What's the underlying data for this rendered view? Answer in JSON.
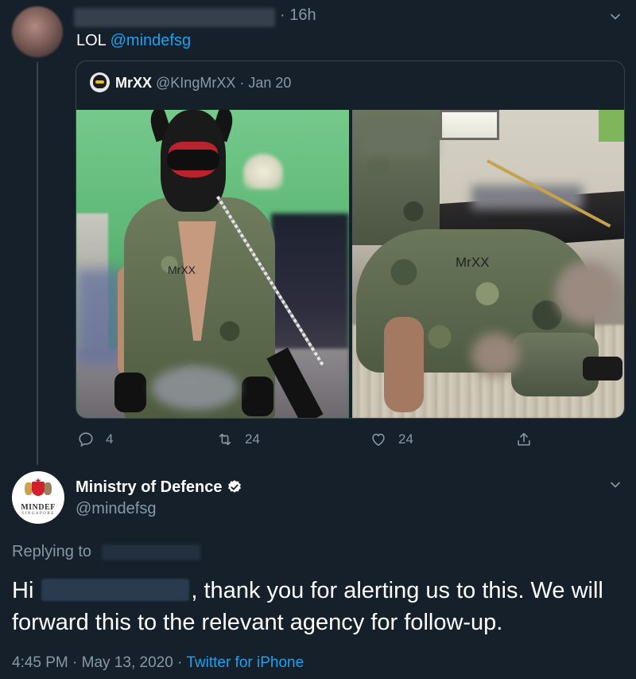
{
  "tweet1": {
    "time": "· 16h",
    "text_prefix": "LOL ",
    "mention": "@mindefsg",
    "quoted": {
      "name": "MrXX",
      "meta": "@KIngMrXX · Jan 20",
      "watermark_left_1": "MrXX",
      "watermark_right_1": "MrXX"
    },
    "actions": {
      "reply_count": "4",
      "retweet_count": "24",
      "like_count": "24"
    }
  },
  "tweet2": {
    "name": "Ministry of Defence",
    "handle": "@mindefsg",
    "avatar_text": "MINDEF",
    "avatar_subtext": "SINGAPORE",
    "replying_label": "Replying to",
    "body_hi": "Hi",
    "body_rest": ", thank you for alerting us to this. We will forward this to the relevant agency for follow-up.",
    "timestamp": "4:45 PM · May 13, 2020 · ",
    "source": "Twitter for iPhone"
  },
  "colors": {
    "background": "#15202b",
    "accent": "#1da1f2",
    "muted": "#8899a6",
    "border": "#38444d"
  },
  "icons": [
    "chevron-down-icon",
    "reply-icon",
    "retweet-icon",
    "like-icon",
    "share-icon",
    "verified-icon"
  ]
}
